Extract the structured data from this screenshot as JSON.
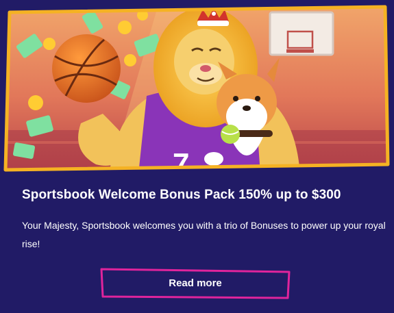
{
  "promo": {
    "title": "Sportsbook Welcome Bonus Pack 150% up to $300",
    "description": "Your Majesty, Sportsbook welcomes you with a trio of Bonuses to power up your royal rise!",
    "button_label": "Read more",
    "jersey_text": "7"
  },
  "colors": {
    "background": "#211b66",
    "frame_gold": "#f5b223",
    "button_border": "#e0249c",
    "jersey_purple": "#8a34b8",
    "lion_mane": "#f4b42a"
  },
  "icons": {
    "banner": "lion-mascot-basketball-illustration",
    "crown": "crown-icon",
    "ball": "basketball-icon",
    "hoop": "basketball-hoop-icon",
    "dog": "corgi-dog-icon"
  }
}
